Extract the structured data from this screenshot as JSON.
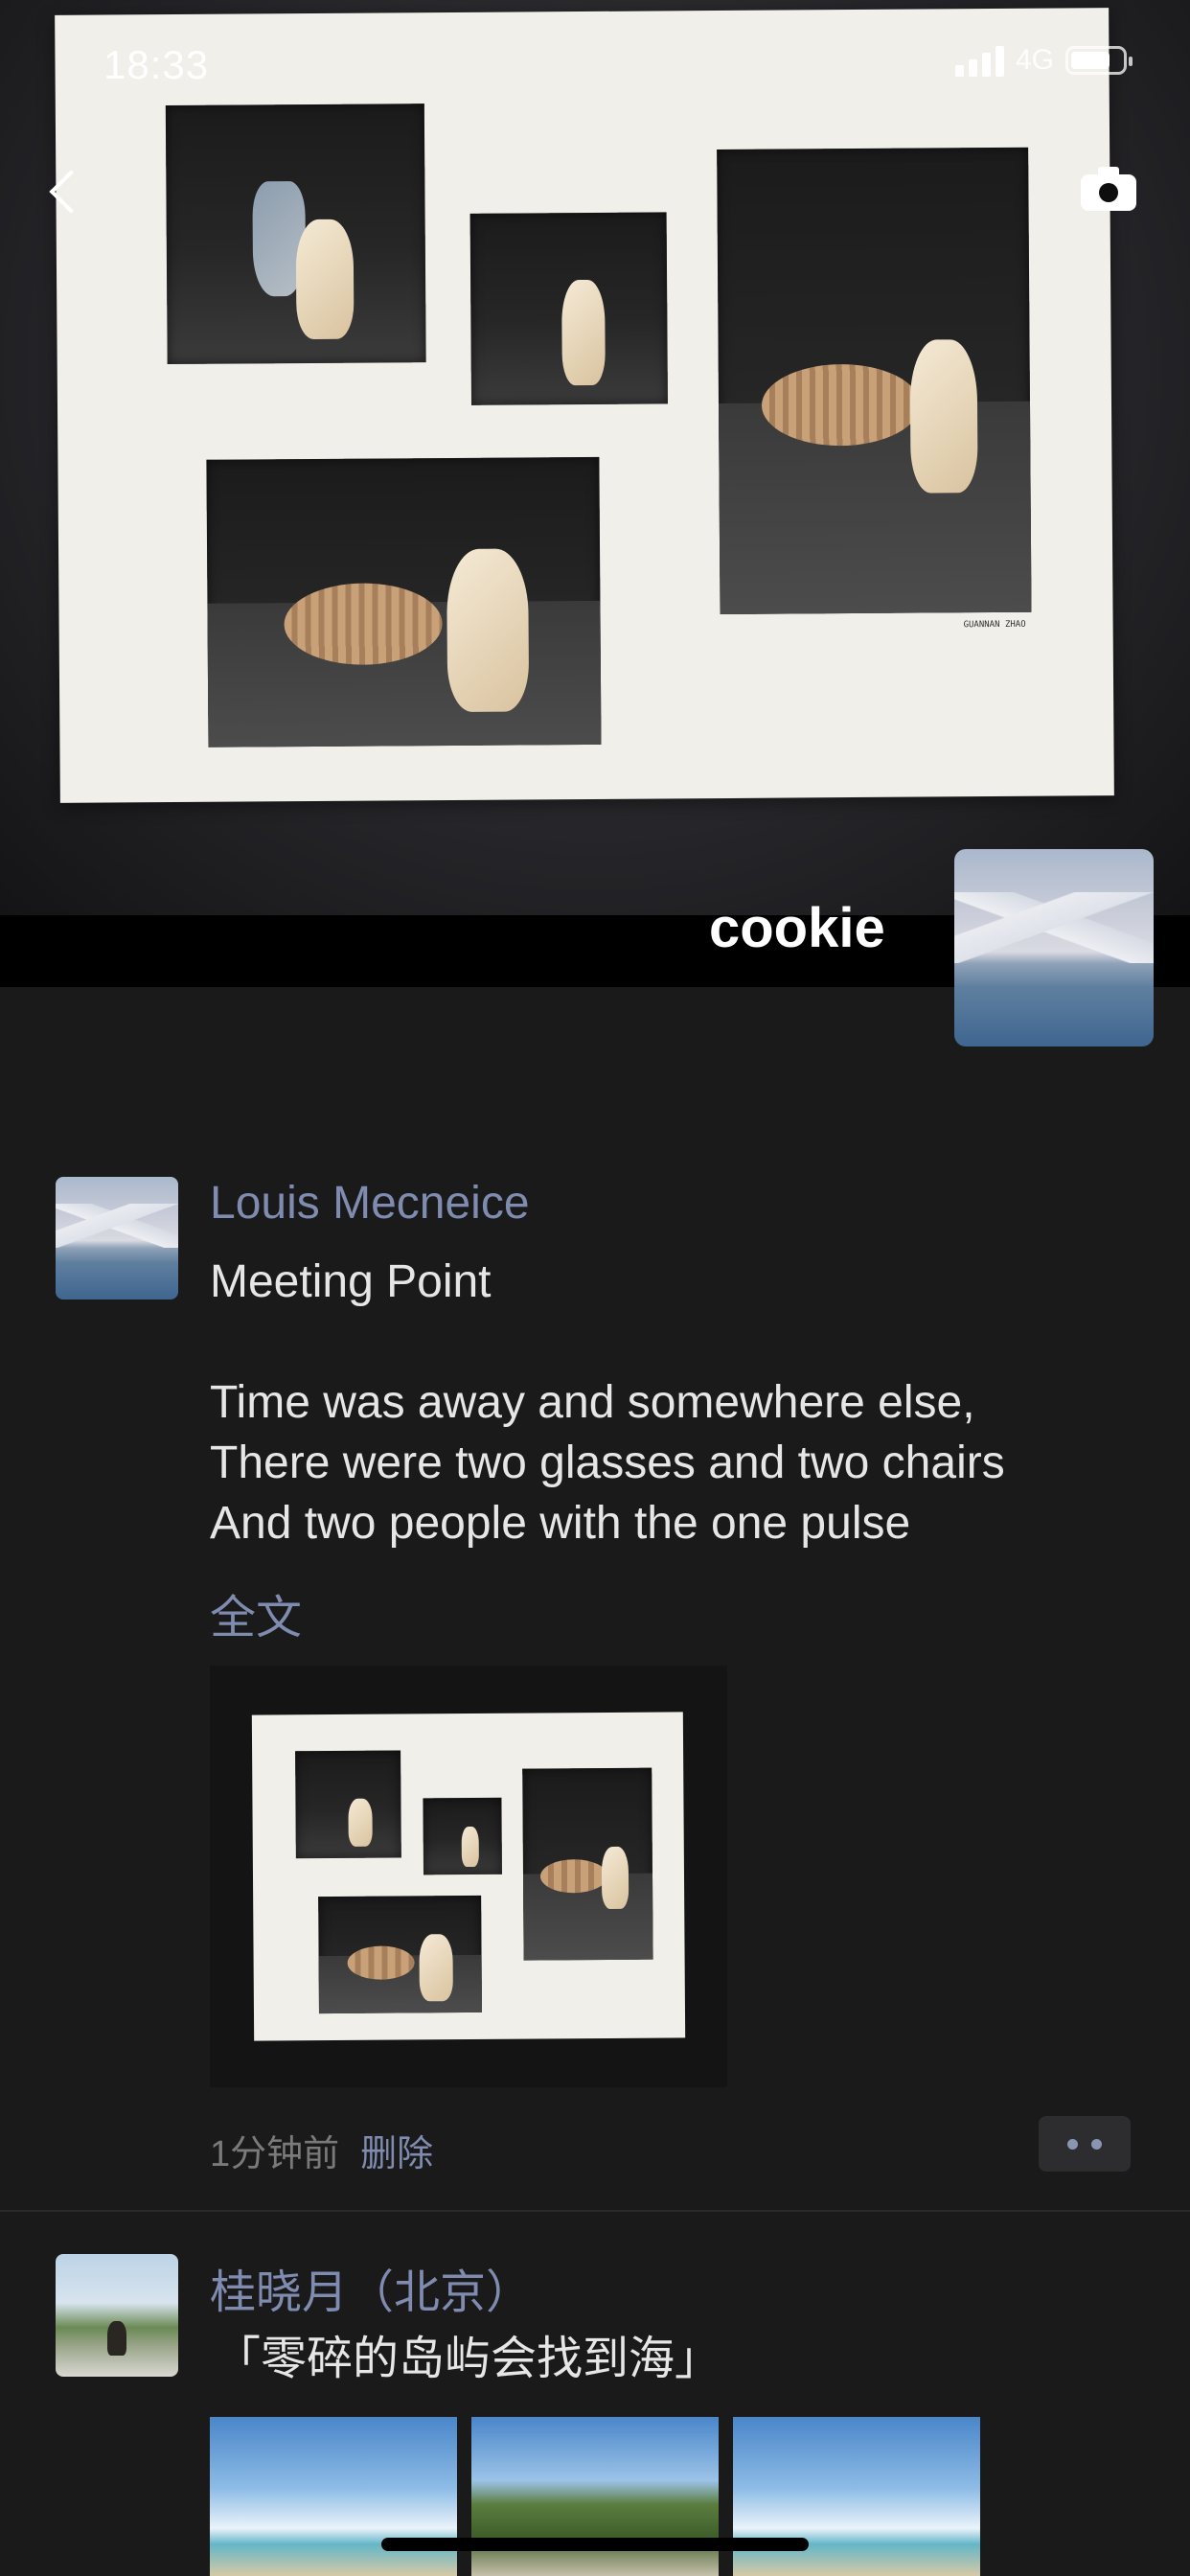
{
  "status_bar": {
    "time": "18:33",
    "network": "4G"
  },
  "cover": {
    "username": "cookie",
    "artwork_signature": "GUANNAN ZHAO"
  },
  "posts": [
    {
      "author": "Louis Mecneice",
      "text": "Meeting Point\n\nTime was away and somewhere else,\nThere were two glasses and two chairs\nAnd two people with the one pulse",
      "full_text_link": "全文",
      "time": "1分钟前",
      "delete_label": "删除"
    },
    {
      "author": "桂晓月（北京）",
      "text": "「零碎的岛屿会找到海」"
    }
  ],
  "icons": {
    "back": "chevron-left-icon",
    "camera": "camera-icon",
    "more": "more-dots-icon"
  },
  "colors": {
    "background": "#1a1a1b",
    "link": "#7f8cb0",
    "text": "#e6e6e6",
    "meta": "#7a7a7a"
  }
}
